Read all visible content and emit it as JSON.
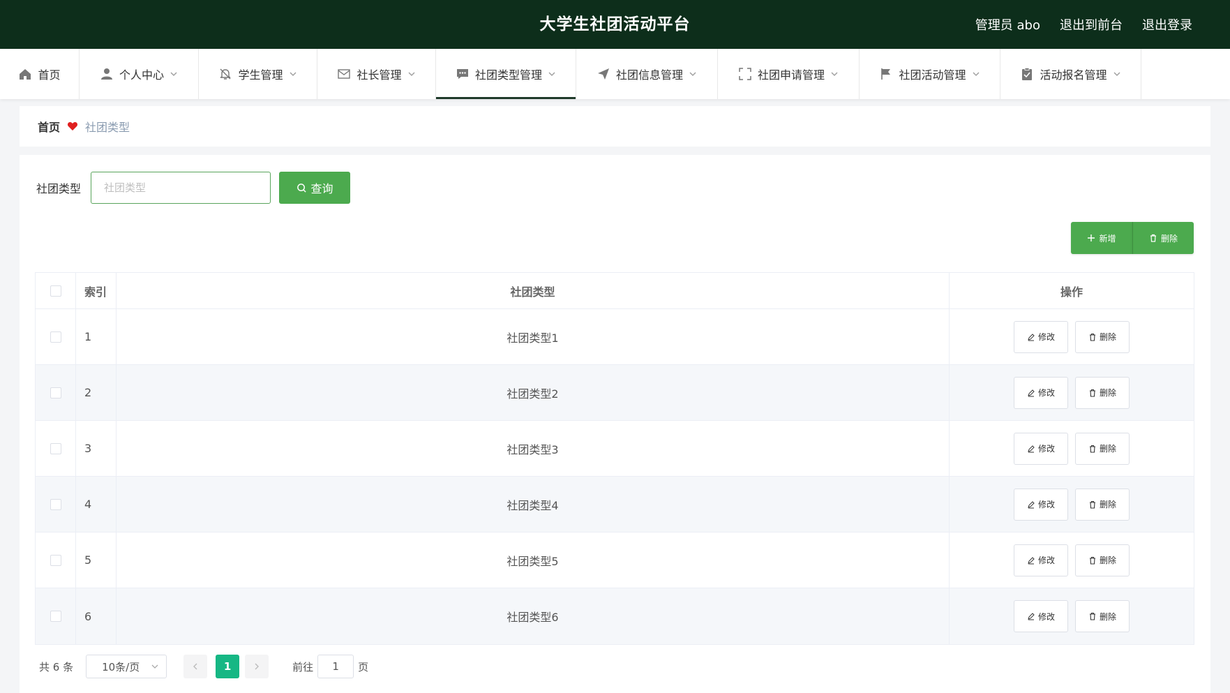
{
  "header": {
    "title": "大学生社团活动平台",
    "admin": "管理员 abo",
    "to_front": "退出到前台",
    "logout": "退出登录"
  },
  "nav": {
    "items": [
      {
        "label": "首页",
        "icon": "home-icon",
        "has_dropdown": false
      },
      {
        "label": "个人中心",
        "icon": "user-icon",
        "has_dropdown": true
      },
      {
        "label": "学生管理",
        "icon": "bell-icon",
        "has_dropdown": true
      },
      {
        "label": "社长管理",
        "icon": "envelope-icon",
        "has_dropdown": true
      },
      {
        "label": "社团类型管理",
        "icon": "chat-icon",
        "has_dropdown": true,
        "active": true
      },
      {
        "label": "社团信息管理",
        "icon": "send-icon",
        "has_dropdown": true
      },
      {
        "label": "社团申请管理",
        "icon": "fullscreen-icon",
        "has_dropdown": true
      },
      {
        "label": "社团活动管理",
        "icon": "flag-icon",
        "has_dropdown": true
      },
      {
        "label": "活动报名管理",
        "icon": "clipboard-icon",
        "has_dropdown": true
      }
    ]
  },
  "breadcrumb": {
    "home": "首页",
    "current": "社团类型"
  },
  "search": {
    "label": "社团类型",
    "placeholder": "社团类型",
    "value": "",
    "button": "查询"
  },
  "actions": {
    "add": "新增",
    "delete": "删除"
  },
  "table": {
    "headers": {
      "index": "索引",
      "type": "社团类型",
      "ops": "操作"
    },
    "rows": [
      {
        "index": "1",
        "type": "社团类型1"
      },
      {
        "index": "2",
        "type": "社团类型2"
      },
      {
        "index": "3",
        "type": "社团类型3"
      },
      {
        "index": "4",
        "type": "社团类型4"
      },
      {
        "index": "5",
        "type": "社团类型5"
      },
      {
        "index": "6",
        "type": "社团类型6"
      }
    ],
    "edit_label": "修改",
    "delete_label": "删除"
  },
  "pagination": {
    "total": "共 6 条",
    "page_size": "10条/页",
    "current_page": "1",
    "goto_label": "前往",
    "goto_value": "1",
    "page_suffix": "页"
  },
  "colors": {
    "header_bg": "#0d2e1b",
    "primary_green": "#4caa4e",
    "page_active": "#16b784"
  }
}
